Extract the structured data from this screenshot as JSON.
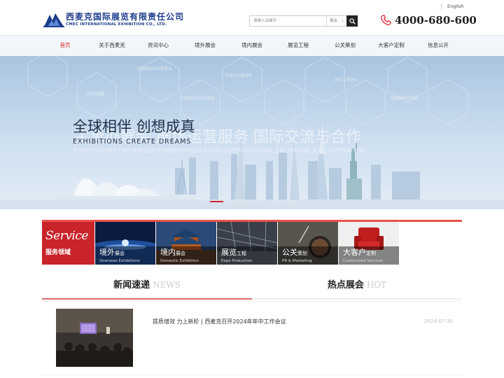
{
  "header": {
    "logo_cn": "西麦克国际展览有限责任公司",
    "logo_en": "CMEC INTERNATIONAL EXHIBITION CO., LTD.",
    "lang": "English",
    "search_placeholder": "请输入关键字",
    "search_select": "展会",
    "phone": "4000-680-600"
  },
  "nav": [
    {
      "label": "首页",
      "active": true
    },
    {
      "label": "关于西麦克"
    },
    {
      "label": "资讯中心"
    },
    {
      "label": "境外展会"
    },
    {
      "label": "境内展会"
    },
    {
      "label": "展览工程"
    },
    {
      "label": "公关策划"
    },
    {
      "label": "大客户定制"
    },
    {
      "label": "信息公开"
    }
  ],
  "banner": {
    "headline_front": "全球相伴 创想成真",
    "headline_back": "主承办展会 展场运营服务 国际交流与合作",
    "sub_front": "EXHIBITIONS CREATE DREAMS",
    "sub_back": "EXPOSITIONS ORGANIZED/UNDERTAKEN BOTH INTERNATIONAL EXCHANGE & COOPERATION",
    "hex_labels": [
      "中国国际机床展览会",
      "印尼机械展",
      "西麦克出展服务",
      "中国国际纺织机械展",
      "国际工程承包",
      "越南国际机床展"
    ],
    "dots": [
      false,
      true,
      false,
      false,
      false,
      false,
      false
    ]
  },
  "services": {
    "logo_big": "Service",
    "logo_small": "服务领域",
    "items": [
      {
        "cn_big": "境外",
        "cn_small": "展会",
        "en": "Overseas Exhibitions"
      },
      {
        "cn_big": "境内",
        "cn_small": "展会",
        "en": "Domestic Exhibition"
      },
      {
        "cn_big": "展览",
        "cn_small": "工程",
        "en": "Expo Production"
      },
      {
        "cn_big": "公关",
        "cn_small": "策划",
        "en": "PR & Marketing"
      },
      {
        "cn_big": "大客户",
        "cn_small": "定制",
        "en": "Customized Services"
      }
    ]
  },
  "tabs": [
    {
      "cn": "新闻速递",
      "en": "NEWS",
      "active": true
    },
    {
      "cn": "热点展会",
      "en": "HOT",
      "active": false
    }
  ],
  "news": {
    "title": "提质增效 力上新阶 | 西麦克召开2024年年中工作会议",
    "date": "2024-07-30"
  },
  "colors": {
    "brand_blue": "#1c3d8c",
    "accent_red": "#d9262c"
  }
}
